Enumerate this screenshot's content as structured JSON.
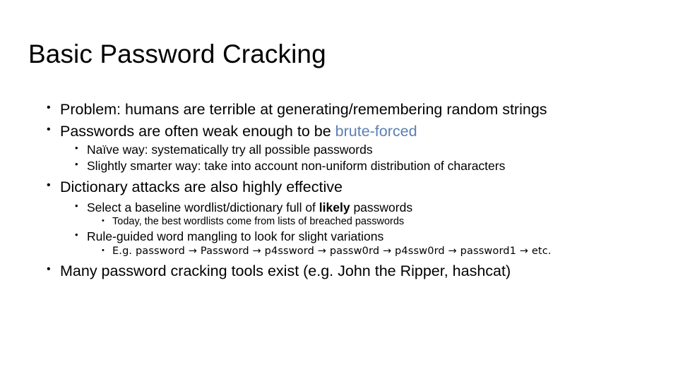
{
  "slide": {
    "title": "Basic Password Cracking",
    "background_color": "#ffffff",
    "text_color": "#000000",
    "accent_color": "#5b7fb4",
    "bullet_glyph": "•",
    "arrow_glyph": "→",
    "content": {
      "b1": {
        "level": 1,
        "text": "Problem: humans are terrible at generating/remembering random strings"
      },
      "b2": {
        "level": 1,
        "text_before": "Passwords are often weak enough to be ",
        "highlight": "brute-forced"
      },
      "b2s1": {
        "level": 2,
        "text": "Naïve way: systematically try all possible passwords"
      },
      "b2s2": {
        "level": 2,
        "text": "Slightly smarter way: take into account non-uniform distribution of characters"
      },
      "b3": {
        "level": 1,
        "text": "Dictionary attacks are also highly effective"
      },
      "b3s1": {
        "level": 2,
        "text_before": "Select a baseline wordlist/dictionary full of ",
        "bold": "likely",
        "text_after": " passwords"
      },
      "b3s1s1": {
        "level": 3,
        "text": "Today, the best wordlists come from lists of breached passwords"
      },
      "b3s2": {
        "level": 2,
        "text": "Rule-guided word mangling to look for slight variations"
      },
      "b3s2s1": {
        "level": 3,
        "prefix": "E.g. ",
        "chain": [
          "password",
          "Password",
          "p4ssword",
          "passw0rd",
          "p4ssw0rd",
          "password1",
          "etc."
        ]
      },
      "b4": {
        "level": 1,
        "text": "Many password cracking tools exist (e.g. John the Ripper, hashcat)"
      }
    }
  }
}
